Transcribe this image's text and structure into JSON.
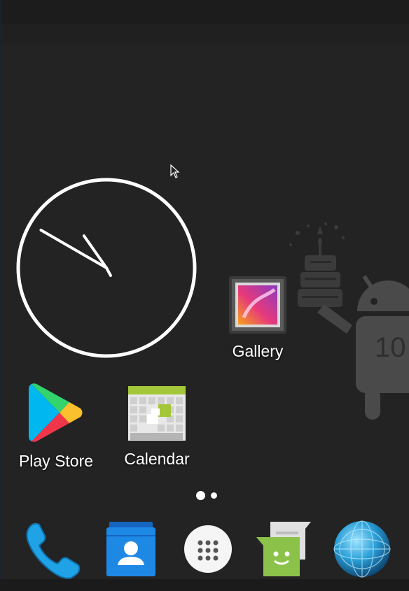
{
  "home": {
    "apps": {
      "gallery": "Gallery",
      "play_store": "Play Store",
      "calendar": "Calendar"
    },
    "clock_widget": {
      "hour": 10,
      "minute": 50
    },
    "wallpaper": {
      "badge_text": "10",
      "description_icon": "android-birthday-cake-icon"
    },
    "page_indicator": {
      "pages": 2,
      "current": 1
    }
  },
  "dock": {
    "items": [
      {
        "icon": "phone-icon"
      },
      {
        "icon": "contacts-icon"
      },
      {
        "icon": "app-drawer-icon"
      },
      {
        "icon": "messaging-icon"
      },
      {
        "icon": "browser-globe-icon"
      }
    ]
  },
  "colors": {
    "background": "#232323",
    "calendar_green": "#a4c639",
    "contacts_blue": "#1e88e5",
    "phone_blue": "#1fa2e6",
    "messaging_green": "#8bc34a"
  }
}
